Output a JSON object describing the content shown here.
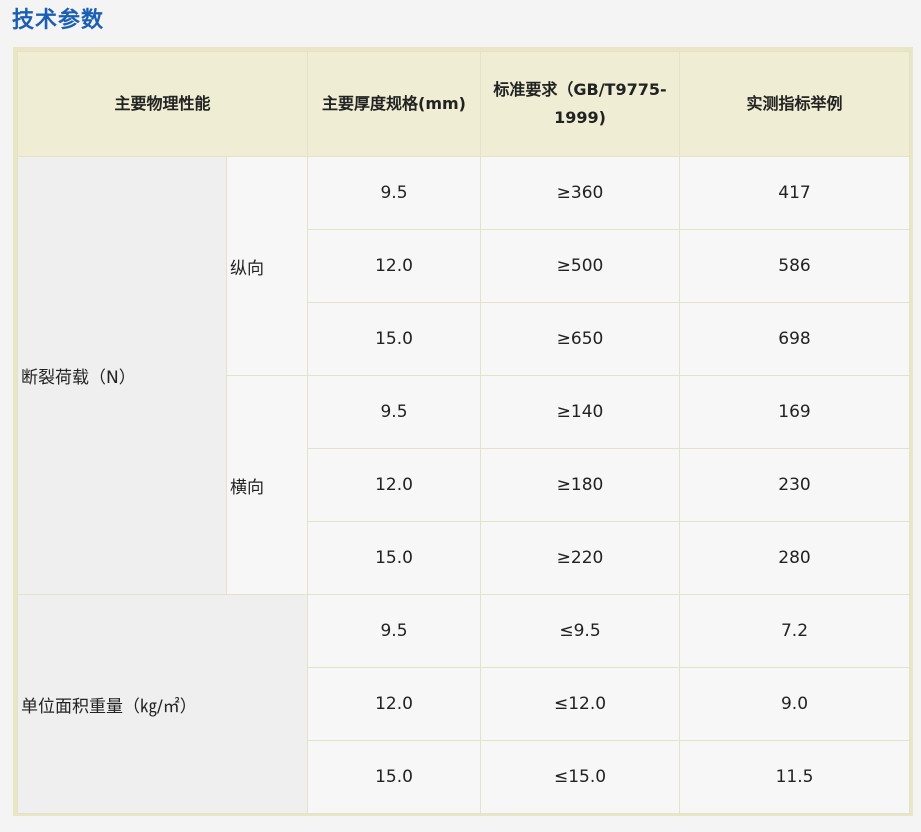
{
  "section_title": "技术参数",
  "table": {
    "headers": {
      "property": "主要物理性能",
      "thickness": "主要厚度规格(mm)",
      "standard": "标准要求（GB/T9775-1999)",
      "measured": "实测指标举例"
    },
    "groups": {
      "breaking_load": {
        "label": "断裂荷载（N）",
        "longitudinal": {
          "label": "纵向",
          "rows": [
            {
              "thickness": "9.5",
              "standard": "≥360",
              "measured": "417"
            },
            {
              "thickness": "12.0",
              "standard": "≥500",
              "measured": "586"
            },
            {
              "thickness": "15.0",
              "standard": "≥650",
              "measured": "698"
            }
          ]
        },
        "transverse": {
          "label": "横向",
          "rows": [
            {
              "thickness": "9.5",
              "standard": "≥140",
              "measured": "169"
            },
            {
              "thickness": "12.0",
              "standard": "≥180",
              "measured": "230"
            },
            {
              "thickness": "15.0",
              "standard": "≥220",
              "measured": "280"
            }
          ]
        }
      },
      "unit_weight": {
        "label": "单位面积重量（㎏/㎡）",
        "rows": [
          {
            "thickness": "9.5",
            "standard": "≤9.5",
            "measured": "7.2"
          },
          {
            "thickness": "12.0",
            "standard": "≤12.0",
            "measured": "9.0"
          },
          {
            "thickness": "15.0",
            "standard": "≤15.0",
            "measured": "11.5"
          }
        ]
      }
    }
  }
}
